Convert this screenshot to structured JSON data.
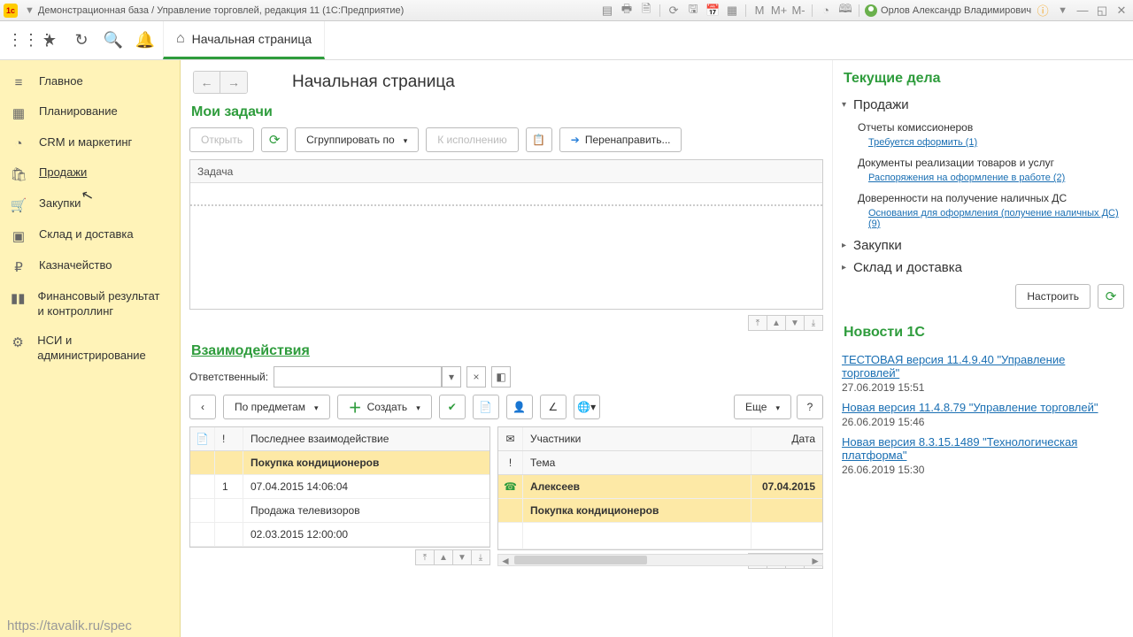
{
  "titlebar": {
    "app": "Демонстрационная база / Управление торговлей, редакция 11 (1С:Предприятие)",
    "user": "Орлов Александр Владимирович"
  },
  "tab": {
    "label": "Начальная страница"
  },
  "sidebar": [
    {
      "label": "Главное"
    },
    {
      "label": "Планирование"
    },
    {
      "label": "CRM и маркетинг"
    },
    {
      "label": "Продажи"
    },
    {
      "label": "Закупки"
    },
    {
      "label": "Склад и доставка"
    },
    {
      "label": "Казначейство"
    },
    {
      "label": "Финансовый результат и контроллинг"
    },
    {
      "label": "НСИ и администрирование"
    }
  ],
  "status_url": "https://tavalik.ru/spec",
  "page": {
    "title": "Начальная страница"
  },
  "tasks": {
    "title": "Мои задачи",
    "open": "Открыть",
    "group_by": "Сгруппировать по",
    "to_execute": "К исполнению",
    "redirect": "Перенаправить...",
    "col": "Задача"
  },
  "interactions": {
    "title": "Взаимодействия",
    "responsible_label": "Ответственный:",
    "by_subject": "По предметам",
    "create": "Создать",
    "more": "Еще",
    "cols_a": {
      "num": "!",
      "last": "Последнее взаимодействие"
    },
    "cols_b": {
      "members": "Участники",
      "date": "Дата",
      "subject": "Тема"
    },
    "rows_a": [
      {
        "title": "Покупка кондиционеров",
        "num": "1",
        "dt": "07.04.2015 14:06:04",
        "sel": true
      },
      {
        "title": "Продажа телевизоров",
        "num": "",
        "dt": "02.03.2015 12:00:00",
        "sel": false
      }
    ],
    "rows_b": [
      {
        "member": "Алексеев",
        "date": "07.04.2015",
        "subject": "Покупка кондиционеров"
      }
    ]
  },
  "affairs": {
    "title": "Текущие дела",
    "configure": "Настроить",
    "groups": [
      {
        "label": "Продажи",
        "open": true,
        "items": [
          {
            "label": "Отчеты комиссионеров",
            "link": "Требуется оформить (1)"
          },
          {
            "label": "Документы реализации товаров и услуг",
            "link": "Распоряжения на оформление в работе (2)"
          },
          {
            "label": "Доверенности на получение наличных ДС",
            "link": "Основания для оформления (получение наличных ДС) (9)"
          }
        ]
      },
      {
        "label": "Закупки",
        "open": false
      },
      {
        "label": "Склад и доставка",
        "open": false
      }
    ]
  },
  "news": {
    "title": "Новости 1С",
    "items": [
      {
        "link": "ТЕСТОВАЯ версия 11.4.9.40 \"Управление торговлей\"",
        "dt": "27.06.2019 15:51"
      },
      {
        "link": "Новая версия 11.4.8.79 \"Управление торговлей\"",
        "dt": "26.06.2019 15:46"
      },
      {
        "link": "Новая версия 8.3.15.1489 \"Технологическая платформа\"",
        "dt": "26.06.2019 15:30"
      }
    ]
  }
}
